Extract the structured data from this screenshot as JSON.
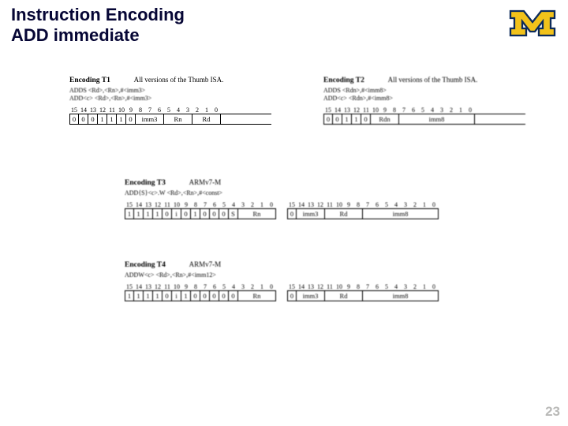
{
  "slide": {
    "title_line1": "Instruction Encoding",
    "title_line2": "ADD immediate",
    "page_number": "23"
  },
  "logo": {
    "name": "michigan-m-logo",
    "color_fill": "#f2c21a",
    "color_outline": "#0b2a5b"
  },
  "t1": {
    "label": "Encoding T1",
    "note": "All versions of the Thumb ISA.",
    "syntax1": "ADDS <Rd>,<Rn>,#<imm3>",
    "syntax2": "ADD<c> <Rd>,<Rn>,#<imm3>",
    "bit_header": [
      "15",
      "14",
      "13",
      "12",
      "11",
      "10",
      "9",
      "8",
      "7",
      "6",
      "5",
      "4",
      "3",
      "2",
      "1",
      "0"
    ],
    "fields": {
      "b15": "0",
      "b14": "0",
      "b13": "0",
      "b12": "1",
      "b11": "1",
      "b10": "1",
      "b9": "0",
      "imm3": "imm3",
      "rn": "Rn",
      "rd": "Rd"
    }
  },
  "t2": {
    "label": "Encoding T2",
    "note": "All versions of the Thumb ISA.",
    "syntax1": "ADDS <Rdn>,#<imm8>",
    "syntax2": "ADD<c> <Rdn>,#<imm8>",
    "bit_header": [
      "15",
      "14",
      "13",
      "12",
      "11",
      "10",
      "9",
      "8",
      "7",
      "6",
      "5",
      "4",
      "3",
      "2",
      "1",
      "0"
    ],
    "fields": {
      "b15": "0",
      "b14": "0",
      "b13": "1",
      "b12": "1",
      "b11": "0",
      "rdn": "Rdn",
      "imm8": "imm8"
    }
  },
  "t3": {
    "label": "Encoding T3",
    "note": "ARMv7-M",
    "syntax1": "ADD{S}<c>.W <Rd>,<Rn>,#<const>",
    "bit_header_hi": [
      "15",
      "14",
      "13",
      "12",
      "11",
      "10",
      "9",
      "8",
      "7",
      "6",
      "5",
      "4",
      "3",
      "2",
      "1",
      "0"
    ],
    "bit_header_lo": [
      "15",
      "14",
      "13",
      "12",
      "11",
      "10",
      "9",
      "8",
      "7",
      "6",
      "5",
      "4",
      "3",
      "2",
      "1",
      "0"
    ],
    "hi": {
      "b15": "1",
      "b14": "1",
      "b13": "1",
      "b12": "1",
      "b11": "0",
      "i": "i",
      "b9": "0",
      "b8": "1",
      "b7": "0",
      "b6": "0",
      "b5": "0",
      "s": "S",
      "rn": "Rn"
    },
    "lo": {
      "b15": "0",
      "imm3": "imm3",
      "rd": "Rd",
      "imm8": "imm8"
    }
  },
  "t4": {
    "label": "Encoding T4",
    "note": "ARMv7-M",
    "syntax1": "ADDW<c> <Rd>,<Rn>,#<imm12>",
    "bit_header_hi": [
      "15",
      "14",
      "13",
      "12",
      "11",
      "10",
      "9",
      "8",
      "7",
      "6",
      "5",
      "4",
      "3",
      "2",
      "1",
      "0"
    ],
    "bit_header_lo": [
      "15",
      "14",
      "13",
      "12",
      "11",
      "10",
      "9",
      "8",
      "7",
      "6",
      "5",
      "4",
      "3",
      "2",
      "1",
      "0"
    ],
    "hi": {
      "b15": "1",
      "b14": "1",
      "b13": "1",
      "b12": "1",
      "b11": "0",
      "i": "i",
      "b9": "1",
      "b8": "0",
      "b7": "0",
      "b6": "0",
      "b5": "0",
      "b4": "0",
      "rn": "Rn"
    },
    "lo": {
      "b15": "0",
      "imm3": "imm3",
      "rd": "Rd",
      "imm8": "imm8"
    }
  }
}
